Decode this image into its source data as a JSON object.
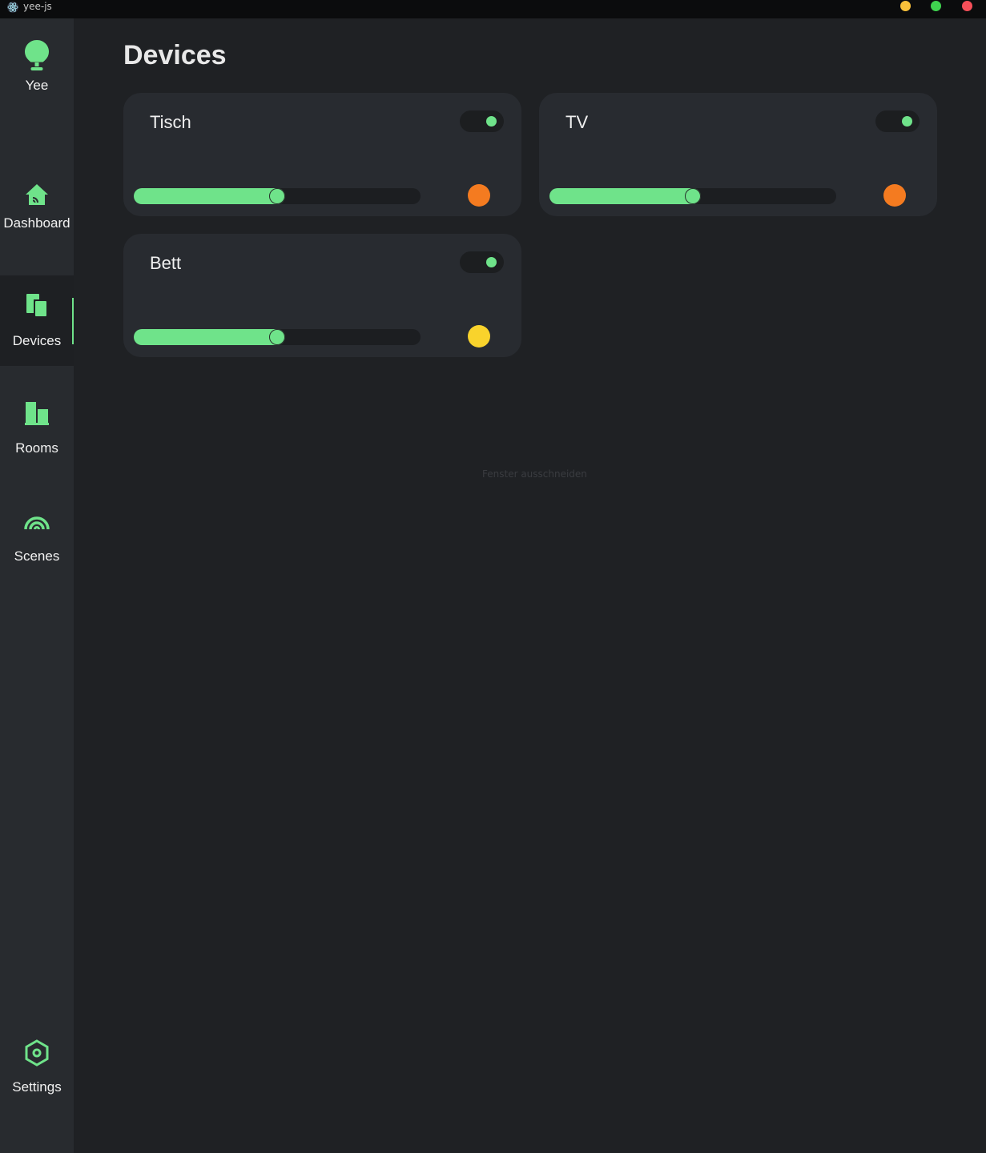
{
  "window": {
    "title": "yee-js",
    "buttons": [
      {
        "name": "minimize",
        "color": "#f9c13a"
      },
      {
        "name": "maximize",
        "color": "#3fd34f"
      },
      {
        "name": "close",
        "color": "#f64f59"
      }
    ]
  },
  "accent_color": "#6fe38a",
  "sidebar": {
    "brand": {
      "label": "Yee",
      "icon": "lightbulb-icon"
    },
    "items": [
      {
        "label": "Dashboard",
        "icon": "home-icon",
        "active": false
      },
      {
        "label": "Devices",
        "icon": "devices-icon",
        "active": true
      },
      {
        "label": "Rooms",
        "icon": "rooms-icon",
        "active": false
      },
      {
        "label": "Scenes",
        "icon": "scenes-icon",
        "active": false
      },
      {
        "label": "Settings",
        "icon": "settings-icon",
        "active": false
      }
    ]
  },
  "main": {
    "title": "Devices",
    "devices": [
      {
        "name": "Tisch",
        "on": true,
        "brightness": 0.5,
        "color": "#f47b20"
      },
      {
        "name": "TV",
        "on": true,
        "brightness": 0.5,
        "color": "#f47b20"
      },
      {
        "name": "Bett",
        "on": true,
        "brightness": 0.5,
        "color": "#f9d32c"
      }
    ],
    "overlay_text": "Fenster ausschneiden"
  }
}
